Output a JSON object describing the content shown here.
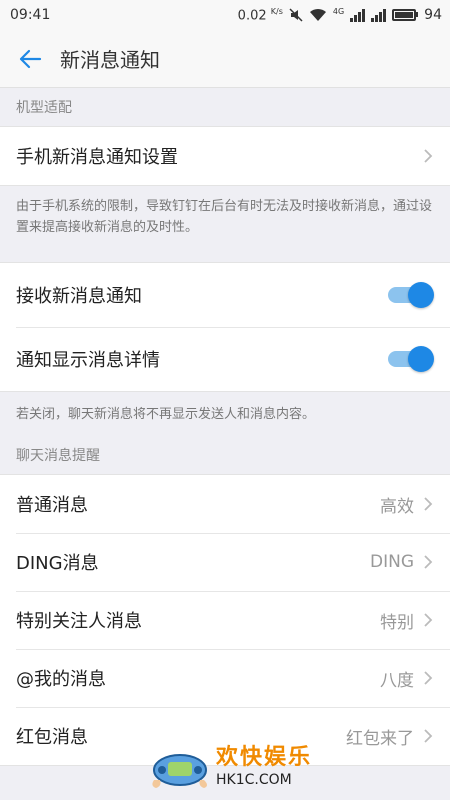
{
  "status_bar": {
    "time": "09:41",
    "speed": "0.02",
    "speed_unit": "K/s",
    "network": "4G",
    "battery": "94"
  },
  "app_bar": {
    "title": "新消息通知"
  },
  "section_device": {
    "label": "机型适配"
  },
  "phone_settings": {
    "label": "手机新消息通知设置"
  },
  "device_note": "由于手机系统的限制，导致钉钉在后台有时无法及时接收新消息，通过设置来提高接收新消息的及时性。",
  "toggles": [
    {
      "label": "接收新消息通知",
      "on": true
    },
    {
      "label": "通知显示消息详情",
      "on": true
    }
  ],
  "toggle_note": "若关闭，聊天新消息将不再显示发送人和消息内容。",
  "section_chat": {
    "label": "聊天消息提醒"
  },
  "chat_items": [
    {
      "label": "普通消息",
      "value": "高效"
    },
    {
      "label": "DING消息",
      "value": "DING"
    },
    {
      "label": "特别关注人消息",
      "value": "特别"
    },
    {
      "label": "@我的消息",
      "value": "八度"
    },
    {
      "label": "红包消息",
      "value": "红包来了"
    }
  ],
  "watermark": {
    "cn": "欢快娱乐",
    "en": "HK1C.COM"
  },
  "colors": {
    "accent": "#1e88e5",
    "toggle_track": "#8cc3ee",
    "background": "#efeff4"
  }
}
